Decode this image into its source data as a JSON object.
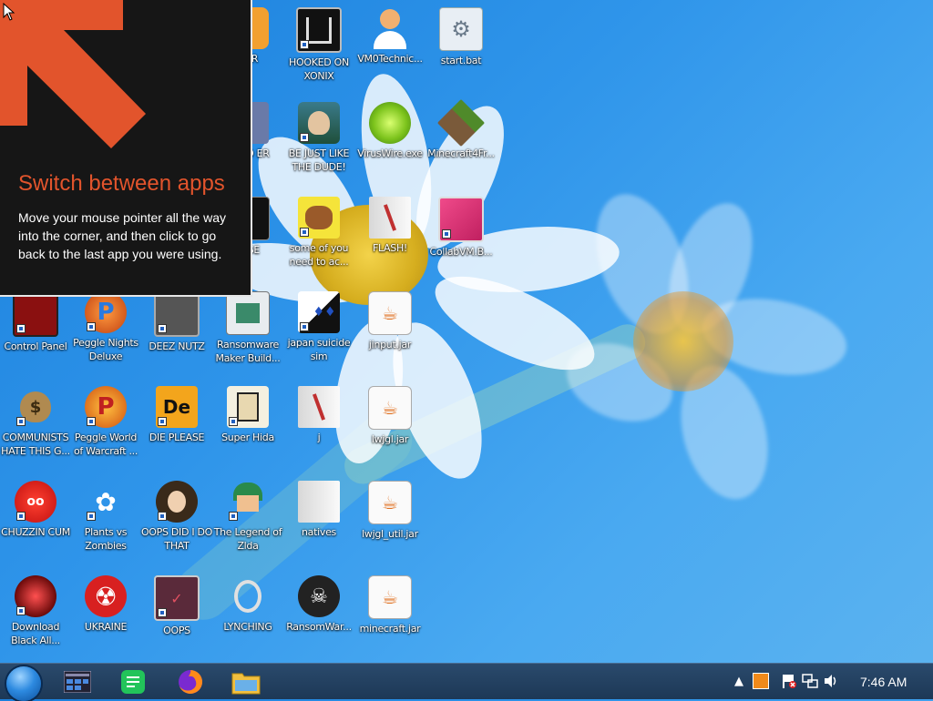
{
  "tip": {
    "title": "Switch between apps",
    "body": "Move your mouse pointer all the way into the corner, and then click to go back to the last app you were using."
  },
  "icons": {
    "tor": "TOR",
    "xonix": "HOOKED ON XONIX",
    "vm0": "VM0Technic...",
    "startbat": "start.bat",
    "card": "CARD ER",
    "dude": "BE JUST LIKE THE DUDE!",
    "viruswire": "VirusWire.exe",
    "minecraft4fr": "Minecraft4Fr...",
    "ypse": "YPSE",
    "someofyou": "some of you need to ac...",
    "flash": "FLASH!",
    "collab": "CollabVM.B...",
    "control": "Control Panel",
    "peggle_nights": "Peggle Nights Deluxe",
    "deez": "DEEZ NUTZ",
    "ransomware_maker": "Ransomware Maker Build...",
    "japan": "japan suicide sim",
    "jinput": "jinput.jar",
    "communists": "COMMUNISTS HATE THIS G...",
    "peggle_wow": "Peggle World of Warcraft ...",
    "die": "DIE PLEASE",
    "hida": "Super Hida",
    "j": "j",
    "lwjgl": "lwjgl.jar",
    "chuzzin": "CHUZZIN CUM",
    "pvz": "Plants vs Zombies",
    "oops_did": "OOPS DID I DO THAT",
    "zelda": "The Legend of Zlda",
    "natives": "natives",
    "lwjgl_util": "lwjgl_util.jar",
    "download": "Download Black All...",
    "ukraine": "UKRAINE",
    "oops": "OOPS",
    "lynching": "LYNCHING",
    "ransomwar": "RansomWar...",
    "minecraftjar": "minecraft.jar"
  },
  "clock": "7:46 AM",
  "colors": {
    "accent": "#e2542c",
    "taskbar": "#1d3856"
  }
}
